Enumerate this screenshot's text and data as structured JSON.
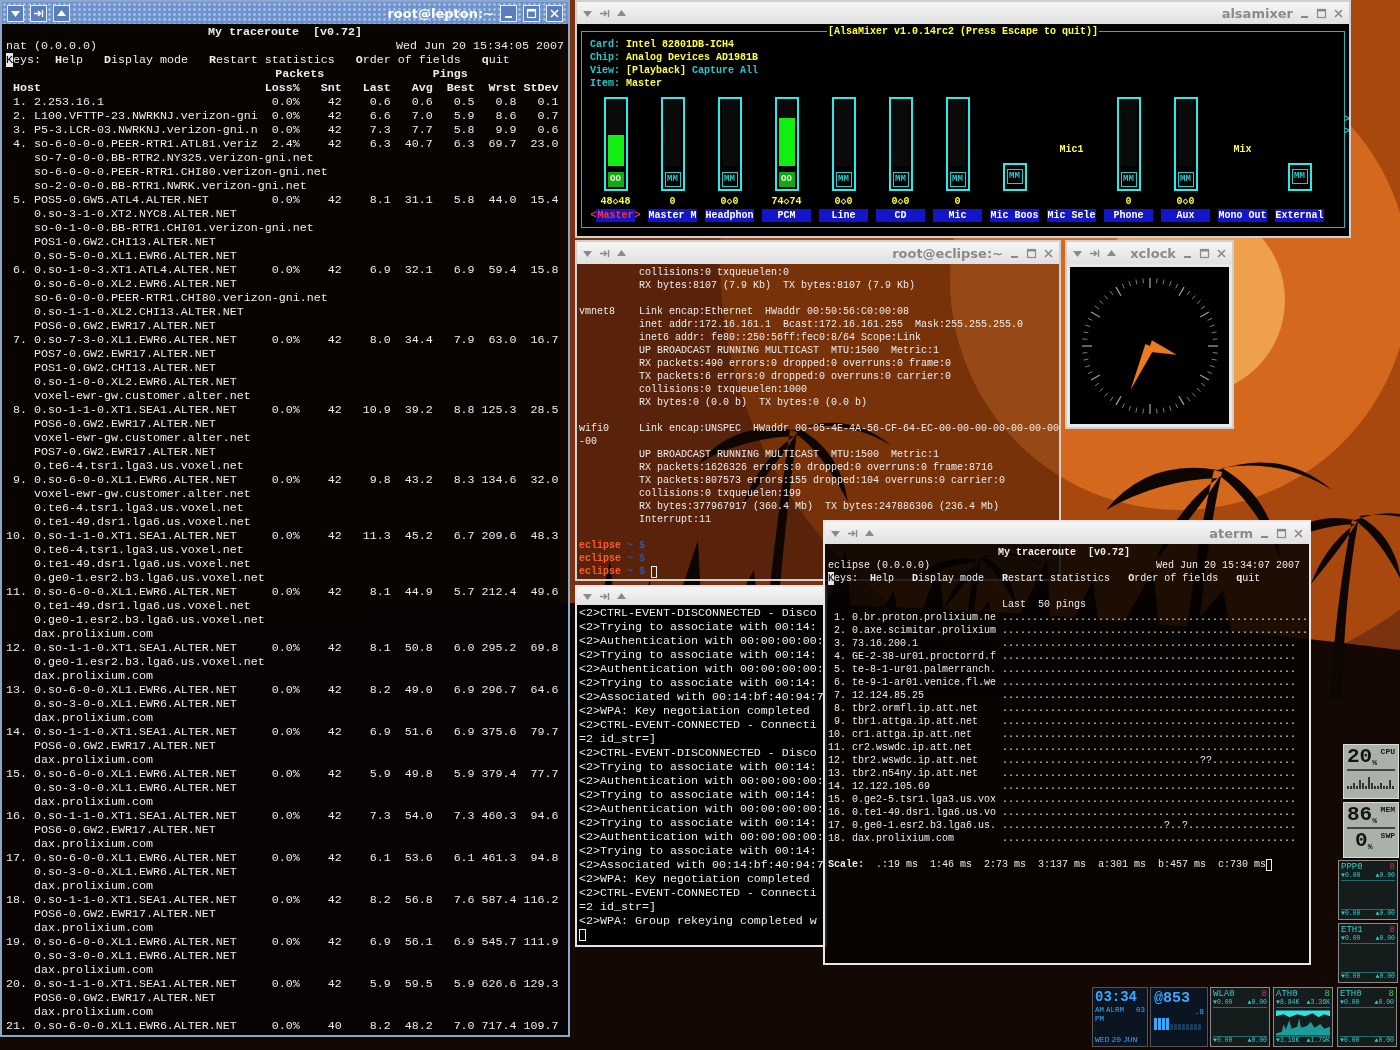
{
  "lepton_terminal": {
    "title": "root@lepton:~",
    "active": true,
    "mtr": {
      "heading": "My traceroute  [v0.72]",
      "host": "nat (0.0.0.0)",
      "date": "Wed Jun 20 15:34:05 2007",
      "keys_label": "Keys:",
      "cursor": true,
      "keys": [
        "**H**elp",
        "**D**isplay mode",
        "**R**estart statistics",
        "**O**rder of fields",
        "**q**uit"
      ],
      "group_headers": [
        "Packets",
        "Pings"
      ],
      "columns": [
        "Host",
        "Loss%",
        "Snt",
        "Last",
        "Avg",
        "Best",
        "Wrst",
        "StDev"
      ],
      "hops": [
        {
          "num": "1.",
          "host": "2.253.16.1",
          "values": [
            "0.0%",
            "42",
            "0.6",
            "0.6",
            "0.5",
            "0.8",
            "0.1"
          ]
        },
        {
          "num": "2.",
          "host": "L100.VFTTP-23.NWRKNJ.verizon-gni",
          "values": [
            "0.0%",
            "42",
            "6.6",
            "7.0",
            "5.9",
            "8.6",
            "0.7"
          ]
        },
        {
          "num": "3.",
          "host": "P5-3.LCR-03.NWRKNJ.verizon-gni.n",
          "values": [
            "0.0%",
            "42",
            "7.3",
            "7.7",
            "5.8",
            "9.9",
            "0.6"
          ]
        },
        {
          "num": "4.",
          "host": "so-6-0-0-0.PEER-RTR1.ATL81.veriz",
          "values": [
            "2.4%",
            "42",
            "6.3",
            "40.7",
            "6.3",
            "69.7",
            "23.0"
          ],
          "alternates": [
            "so-7-0-0-0.BB-RTR2.NY325.verizon-gni.net",
            "so-6-0-0-0.PEER-RTR1.CHI80.verizon-gni.net",
            "so-2-0-0-0.BB-RTR1.NWRK.verizon-gni.net"
          ]
        },
        {
          "num": "5.",
          "host": "POS5-0.GW5.ATL4.ALTER.NET",
          "values": [
            "0.0%",
            "42",
            "8.1",
            "31.1",
            "5.8",
            "44.0",
            "15.4"
          ],
          "alternates": [
            "0.so-3-1-0.XT2.NYC8.ALTER.NET",
            "so-0-1-0-0.BB-RTR1.CHI01.verizon-gni.net",
            "POS1-0.GW2.CHI13.ALTER.NET",
            "0.so-5-0-0.XL1.EWR6.ALTER.NET"
          ]
        },
        {
          "num": "6.",
          "host": "0.so-1-0-3.XT1.ATL4.ALTER.NET",
          "values": [
            "0.0%",
            "42",
            "6.9",
            "32.1",
            "6.9",
            "59.4",
            "15.8"
          ],
          "alternates": [
            "0.so-6-0-0.XL2.EWR6.ALTER.NET",
            "so-6-0-0-0.PEER-RTR1.CHI80.verizon-gni.net",
            "0.so-1-1-0.XL2.CHI13.ALTER.NET",
            "POS6-0.GW2.EWR17.ALTER.NET"
          ]
        },
        {
          "num": "7.",
          "host": "0.so-7-3-0.XL1.EWR6.ALTER.NET",
          "values": [
            "0.0%",
            "42",
            "8.0",
            "34.4",
            "7.9",
            "63.0",
            "16.7"
          ],
          "alternates": [
            "POS7-0.GW2.EWR17.ALTER.NET",
            "POS1-0.GW2.CHI13.ALTER.NET",
            "0.so-1-0-0.XL2.EWR6.ALTER.NET",
            "voxel-ewr-gw.customer.alter.net"
          ]
        },
        {
          "num": "8.",
          "host": "0.so-1-1-0.XT1.SEA1.ALTER.NET",
          "values": [
            "0.0%",
            "42",
            "10.9",
            "39.2",
            "8.8",
            "125.3",
            "28.5"
          ],
          "alternates": [
            "POS6-0.GW2.EWR17.ALTER.NET",
            "voxel-ewr-gw.customer.alter.net",
            "POS7-0.GW2.EWR17.ALTER.NET",
            "0.te6-4.tsr1.lga3.us.voxel.net"
          ]
        },
        {
          "num": "9.",
          "host": "0.so-6-0-0.XL1.EWR6.ALTER.NET",
          "values": [
            "0.0%",
            "42",
            "9.8",
            "43.2",
            "8.3",
            "134.6",
            "32.0"
          ],
          "alternates": [
            "voxel-ewr-gw.customer.alter.net",
            "0.te6-4.tsr1.lga3.us.voxel.net",
            "0.te1-49.dsr1.lga6.us.voxel.net"
          ]
        },
        {
          "num": "10.",
          "host": "0.so-1-1-0.XT1.SEA1.ALTER.NET",
          "values": [
            "0.0%",
            "42",
            "11.3",
            "45.2",
            "6.7",
            "209.6",
            "48.3"
          ],
          "alternates": [
            "0.te6-4.tsr1.lga3.us.voxel.net",
            "0.te1-49.dsr1.lga6.us.voxel.net",
            "0.ge0-1.esr2.b3.lga6.us.voxel.net"
          ]
        },
        {
          "num": "11.",
          "host": "0.so-6-0-0.XL1.EWR6.ALTER.NET",
          "values": [
            "0.0%",
            "42",
            "8.1",
            "44.9",
            "5.7",
            "212.4",
            "49.6"
          ],
          "alternates": [
            "0.te1-49.dsr1.lga6.us.voxel.net",
            "0.ge0-1.esr2.b3.lga6.us.voxel.net",
            "dax.prolixium.com"
          ]
        },
        {
          "num": "12.",
          "host": "0.so-1-1-0.XT1.SEA1.ALTER.NET",
          "values": [
            "0.0%",
            "42",
            "8.1",
            "50.8",
            "6.0",
            "295.2",
            "69.8"
          ],
          "alternates": [
            "0.ge0-1.esr2.b3.lga6.us.voxel.net",
            "dax.prolixium.com"
          ]
        },
        {
          "num": "13.",
          "host": "0.so-6-0-0.XL1.EWR6.ALTER.NET",
          "values": [
            "0.0%",
            "42",
            "8.2",
            "49.0",
            "6.9",
            "296.7",
            "64.6"
          ],
          "alternates": [
            "0.so-3-0-0.XL1.EWR6.ALTER.NET",
            "dax.prolixium.com"
          ]
        },
        {
          "num": "14.",
          "host": "0.so-1-1-0.XT1.SEA1.ALTER.NET",
          "values": [
            "0.0%",
            "42",
            "6.9",
            "51.6",
            "6.9",
            "375.6",
            "79.7"
          ],
          "alternates": [
            "POS6-0.GW2.EWR17.ALTER.NET",
            "dax.prolixium.com"
          ]
        },
        {
          "num": "15.",
          "host": "0.so-6-0-0.XL1.EWR6.ALTER.NET",
          "values": [
            "0.0%",
            "42",
            "5.9",
            "49.8",
            "5.9",
            "379.4",
            "77.7"
          ],
          "alternates": [
            "0.so-3-0-0.XL1.EWR6.ALTER.NET",
            "dax.prolixium.com"
          ]
        },
        {
          "num": "16.",
          "host": "0.so-1-1-0.XT1.SEA1.ALTER.NET",
          "values": [
            "0.0%",
            "42",
            "7.3",
            "54.0",
            "7.3",
            "460.3",
            "94.6"
          ],
          "alternates": [
            "POS6-0.GW2.EWR17.ALTER.NET",
            "dax.prolixium.com"
          ]
        },
        {
          "num": "17.",
          "host": "0.so-6-0-0.XL1.EWR6.ALTER.NET",
          "values": [
            "0.0%",
            "42",
            "6.1",
            "53.6",
            "6.1",
            "461.3",
            "94.8"
          ],
          "alternates": [
            "0.so-3-0-0.XL1.EWR6.ALTER.NET",
            "dax.prolixium.com"
          ]
        },
        {
          "num": "18.",
          "host": "0.so-1-1-0.XT1.SEA1.ALTER.NET",
          "values": [
            "0.0%",
            "42",
            "8.2",
            "56.8",
            "7.6",
            "587.4",
            "116.2"
          ],
          "alternates": [
            "POS6-0.GW2.EWR17.ALTER.NET",
            "dax.prolixium.com"
          ]
        },
        {
          "num": "19.",
          "host": "0.so-6-0-0.XL1.EWR6.ALTER.NET",
          "values": [
            "0.0%",
            "42",
            "6.9",
            "56.1",
            "6.9",
            "545.7",
            "111.9"
          ],
          "alternates": [
            "0.so-3-0-0.XL1.EWR6.ALTER.NET",
            "dax.prolixium.com"
          ]
        },
        {
          "num": "20.",
          "host": "0.so-1-1-0.XT1.SEA1.ALTER.NET",
          "values": [
            "0.0%",
            "42",
            "5.9",
            "59.5",
            "5.9",
            "626.6",
            "129.3"
          ],
          "alternates": [
            "POS6-0.GW2.EWR17.ALTER.NET",
            "dax.prolixium.com"
          ]
        },
        {
          "num": "21.",
          "host": "0.so-6-0-0.XL1.EWR6.ALTER.NET",
          "values": [
            "0.0%",
            "40",
            "8.2",
            "48.2",
            "7.0",
            "717.4",
            "109.7"
          ]
        }
      ]
    }
  },
  "alsamixer": {
    "title": "alsamixer",
    "active": false,
    "heading": "[AlsaMixer v1.0.14rc2 (Press Escape to quit)]",
    "card_label": "Card:",
    "card": "Intel 82801DB-ICH4",
    "chip_label": "Chip:",
    "chip": "Analog Devices AD1981B",
    "view_label": "View:",
    "views": [
      {
        "label": "[Playback]",
        "selected": true
      },
      {
        "label": "Capture",
        "selected": false
      },
      {
        "label": "All",
        "selected": false
      }
    ],
    "item_label": "Item:",
    "item": "Master",
    "selection_marks": [
      "<",
      ">"
    ],
    "scroll_marks": [
      ">",
      ">"
    ],
    "channels": [
      {
        "name": "Master",
        "kind": "volume",
        "level": 0.48,
        "value": "48◇48",
        "mute_label": "OO",
        "muted": false,
        "selected": true
      },
      {
        "name": "Master M",
        "kind": "volume",
        "level": 0,
        "value": "0",
        "mute_label": "MM",
        "muted": true,
        "selected": false
      },
      {
        "name": "Headphon",
        "kind": "volume",
        "level": 0,
        "value": "0◇0",
        "mute_label": "MM",
        "muted": true,
        "selected": false
      },
      {
        "name": "PCM",
        "kind": "volume",
        "level": 0.74,
        "value": "74◇74",
        "mute_label": "OO",
        "muted": false,
        "selected": false
      },
      {
        "name": "Line",
        "kind": "volume",
        "level": 0,
        "value": "0◇0",
        "mute_label": "MM",
        "muted": true,
        "selected": false
      },
      {
        "name": "CD",
        "kind": "volume",
        "level": 0,
        "value": "0◇0",
        "mute_label": "MM",
        "muted": true,
        "selected": false
      },
      {
        "name": "Mic",
        "kind": "volume",
        "level": 0,
        "value": "0",
        "mute_label": "MM",
        "muted": true,
        "selected": false
      },
      {
        "name": "Mic Boos",
        "kind": "switch",
        "mute_label": "MM",
        "muted": true,
        "selected": false
      },
      {
        "name": "Mic Sele",
        "kind": "enum",
        "option": "Mic1",
        "selected": false
      },
      {
        "name": "Phone",
        "kind": "volume",
        "level": 0,
        "value": "0",
        "mute_label": "MM",
        "muted": true,
        "selected": false
      },
      {
        "name": "Aux",
        "kind": "volume",
        "level": 0,
        "value": "0◇0",
        "mute_label": "MM",
        "muted": true,
        "selected": false
      },
      {
        "name": "Mono Out",
        "kind": "enum",
        "option": "Mix",
        "selected": false
      },
      {
        "name": "External",
        "kind": "switch",
        "mute_label": "MM",
        "muted": true,
        "selected": false
      }
    ]
  },
  "eclipse_terminal": {
    "title": "root@eclipse:~",
    "active": false,
    "blocks": [
      {
        "lines": [
          "collisions:0 txqueuelen:0",
          "RX bytes:8107 (7.9 Kb)  TX bytes:8107 (7.9 Kb)"
        ]
      },
      {
        "iface": "vmnet8",
        "lines": [
          "Link encap:Ethernet  HWaddr 00:50:56:C0:00:08",
          "inet addr:172.16.161.1  Bcast:172.16.161.255  Mask:255.255.255.0",
          "inet6 addr: fe80::250:56ff:fec0:8/64 Scope:Link",
          "UP BROADCAST RUNNING MULTICAST  MTU:1500  Metric:1",
          "RX packets:490 errors:0 dropped:0 overruns:0 frame:0",
          "TX packets:6 errors:0 dropped:0 overruns:0 carrier:0",
          "collisions:0 txqueuelen:1000",
          "RX bytes:0 (0.0 b)  TX bytes:0 (0.0 b)"
        ]
      },
      {
        "iface": "wifi0",
        "wrapped": "-00",
        "lines": [
          "Link encap:UNSPEC  HWaddr 00-05-4E-4A-56-CF-64-EC-00-00-00-00-00-00-00",
          "UP BROADCAST RUNNING MULTICAST  MTU:1500  Metric:1",
          "RX packets:1626326 errors:0 dropped:0 overruns:0 frame:8716",
          "TX packets:807573 errors:155 dropped:104 overruns:0 carrier:0",
          "collisions:0 txqueuelen:199",
          "RX bytes:377967917 (360.4 Mb)  TX bytes:247886306 (236.4 Mb)",
          "Interrupt:11"
        ]
      }
    ],
    "prompts": [
      {
        "host": "eclipse",
        "path": "~",
        "symbol": "$",
        "cursor": false
      },
      {
        "host": "eclipse",
        "path": "~",
        "symbol": "$",
        "cursor": false
      },
      {
        "host": "eclipse",
        "path": "~",
        "symbol": "$",
        "cursor": true
      }
    ]
  },
  "xclock": {
    "title": "xclock",
    "active": false
  },
  "wpa_terminal": {
    "active": false,
    "cursor": true,
    "lines": [
      "<2>CTRL-EVENT-DISCONNECTED - Disco",
      "<2>Trying to associate with 00:14:",
      "<2>Authentication with 00:00:00:00:",
      "<2>Trying to associate with 00:14:",
      "<2>Authentication with 00:00:00:00:",
      "<2>Trying to associate with 00:14:",
      "<2>Associated with 00:14:bf:40:94:7",
      "<2>WPA: Key negotiation completed",
      "<2>CTRL-EVENT-CONNECTED - Connecti",
      "=2 id_str=]",
      "<2>CTRL-EVENT-DISCONNECTED - Disco",
      "<2>Trying to associate with 00:14:",
      "<2>Authentication with 00:00:00:00:",
      "<2>Trying to associate with 00:14:",
      "<2>Authentication with 00:00:00:00:",
      "<2>Trying to associate with 00:14:",
      "<2>Authentication with 00:00:00:00:",
      "<2>Trying to associate with 00:14:",
      "<2>Associated with 00:14:bf:40:94:7",
      "<2>WPA: Key negotiation completed",
      "<2>CTRL-EVENT-CONNECTED - Connecti",
      "=2 id_str=]",
      "<2>WPA: Group rekeying completed w"
    ]
  },
  "aterm": {
    "title": "aterm",
    "active": false,
    "mtr": {
      "heading": "My traceroute  [v0.72]",
      "host": "eclipse (0.0.0.0)",
      "date": "Wed Jun 20 15:34:07 2007",
      "keys_label": "Keys:",
      "keys": [
        "**H**elp",
        "**D**isplay mode",
        "**R**estart statistics",
        "**O**rder of fields",
        "**q**uit"
      ],
      "history_header": "Last  50 pings",
      "hops": [
        {
          "num": "1.",
          "host": "0.br.proton.prolixium.ne",
          "pings": "..................................................."
        },
        {
          "num": "2.",
          "host": "0.axe.scimitar.prolixium",
          "pings": "..................................................."
        },
        {
          "num": "3.",
          "host": "73.16.200.1",
          "pings": "................................................."
        },
        {
          "num": "4.",
          "host": "GE-2-38-ur01.proctorrd.f",
          "pings": "................................................."
        },
        {
          "num": "5.",
          "host": "te-8-1-ur01.palmerranch.",
          "pings": "................................................."
        },
        {
          "num": "6.",
          "host": "te-9-1-ar01.venice.fl.we",
          "pings": "................................................."
        },
        {
          "num": "7.",
          "host": "12.124.85.25",
          "pings": "................................................."
        },
        {
          "num": "8.",
          "host": "tbr2.ormfl.ip.att.net",
          "pings": "................................................."
        },
        {
          "num": "9.",
          "host": "tbr1.attga.ip.att.net",
          "pings": "................................................."
        },
        {
          "num": "10.",
          "host": "cr1.attga.ip.att.net",
          "pings": "................................................."
        },
        {
          "num": "11.",
          "host": "cr2.wswdc.ip.att.net",
          "pings": "................................................."
        },
        {
          "num": "12.",
          "host": "tbr2.wswdc.ip.att.net",
          "pings": ".................................??.............."
        },
        {
          "num": "13.",
          "host": "tbr2.n54ny.ip.att.net",
          "pings": "................................................."
        },
        {
          "num": "14.",
          "host": "12.122.105.69",
          "pings": "................................................."
        },
        {
          "num": "15.",
          "host": "0.ge2-5.tsr1.lga3.us.vox",
          "pings": "................................................."
        },
        {
          "num": "16.",
          "host": "0.te1-49.dsr1.lga6.us.vo",
          "pings": "................................................."
        },
        {
          "num": "17.",
          "host": "0.ge0-1.esr2.b3.lga6.us.",
          "pings": "...........................?..?.................."
        },
        {
          "num": "18.",
          "host": "dax.prolixium.com",
          "pings": "................................................."
        }
      ],
      "scale_label": "Scale:",
      "scale": [
        ".:19 ms",
        "1:46 ms",
        "2:73 ms",
        "3:137 ms",
        "a:301 ms",
        "b:457 ms",
        "c:730 ms"
      ],
      "cursor": true
    }
  },
  "dockapps": {
    "cpu": {
      "label": "CPU",
      "value": "20",
      "unit": "%"
    },
    "memory": {
      "mem_label": "MEM",
      "mem_value": "86",
      "mem_unit": "%",
      "swap_label": "SWP",
      "swap_value": "0",
      "swap_unit": "%"
    },
    "net": [
      {
        "name": "PPP0",
        "indicator": "8",
        "link_up": false,
        "rx": "▼0.00",
        "tx": "▲0.00",
        "rx_total": "▼0.00",
        "tx_total": "▲0.00",
        "traffic": false
      },
      {
        "name": "ETH1",
        "indicator": "8",
        "link_up": false,
        "rx": "▼0.00",
        "tx": "▲0.00",
        "rx_total": "▼0.00",
        "tx_total": "▲0.00",
        "traffic": false
      },
      {
        "name": "WLA0",
        "indicator": "8",
        "link_up": false,
        "rx": "▼0.00",
        "tx": "▲0.00",
        "rx_total": "▼0.00",
        "tx_total": "▲0.00",
        "traffic": false
      },
      {
        "name": "ATH0",
        "indicator": "8",
        "link_up": true,
        "rx": "▼8.84K",
        "tx": "▲3.36K",
        "rx_total": "▼3.16K",
        "tx_total": "▲1.79K",
        "traffic": true
      },
      {
        "name": "ETH0",
        "indicator": "8",
        "link_up": true,
        "rx": "▼0.00",
        "tx": "▲0.00",
        "rx_total": "▼0.00",
        "tx_total": "▲0.00",
        "traffic": false
      }
    ],
    "clock": {
      "time": "03:34",
      "am": "AM",
      "alarm": "ALRM",
      "seconds": "03",
      "pm": "PM",
      "weekday": "WED",
      "day": "20",
      "month": "JUN"
    },
    "beat": {
      "value": "@853",
      "fraction": ".8"
    }
  }
}
